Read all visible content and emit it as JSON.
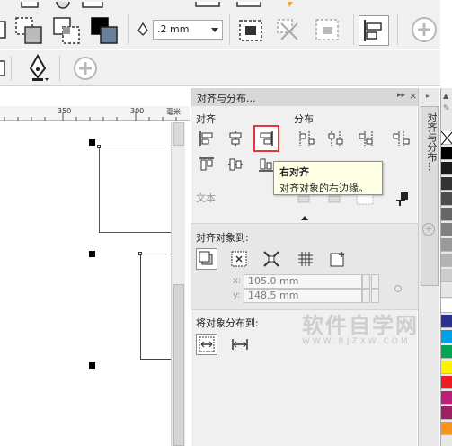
{
  "toolbar": {
    "outline_width_value": ".2 mm",
    "icons": [
      "weld-icon",
      "trim-icon",
      "intersect-icon",
      "simplify-icon",
      "front-minus-back-icon",
      "outline-pen-icon",
      "combine-icon",
      "break-apart-icon",
      "align-distribute-icon",
      "add-icon",
      "pen-tool-icon"
    ]
  },
  "ruler": {
    "labels": [
      "350",
      "300",
      "毫米"
    ]
  },
  "docker": {
    "title": "对齐与分布...",
    "align_label": "对齐",
    "distribute_label": "分布",
    "text_label": "文本",
    "align_to_label": "对齐对象到:",
    "x_label": "x:",
    "x_value": "105.0 mm",
    "y_label": "y:",
    "y_value": "148.5 mm",
    "distribute_to_label": "将对象分布到:"
  },
  "tooltip": {
    "title": "右对齐",
    "description": "对齐对象的右边缘。"
  },
  "side_tab": {
    "label": "对齐与分布..."
  },
  "palette": {
    "colors": [
      "#ffffff",
      "#000000",
      "#1a1a1a",
      "#333333",
      "#4d4d4d",
      "#666666",
      "#808080",
      "#999999",
      "#b3b3b3",
      "#cccccc",
      "#e6e6e6",
      "#ffffff",
      "#2b2f8f",
      "#00a0e9",
      "#00a651",
      "#fff200",
      "#ed1c24",
      "#be1e78",
      "#9e1f63",
      "#f7941d"
    ]
  },
  "watermark": {
    "line1": "软件自学网",
    "line2": "WWW.RJZXW.COM"
  }
}
